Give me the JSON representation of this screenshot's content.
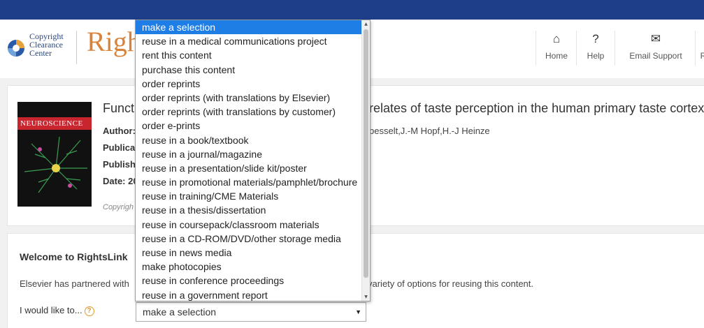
{
  "logo": {
    "lines": [
      "Copyright",
      "Clearance",
      "Center"
    ]
  },
  "brand": {
    "title": "RightsLink"
  },
  "nav": [
    {
      "label": "Home",
      "icon": "home-icon",
      "glyph": "⌂"
    },
    {
      "label": "Help",
      "icon": "help-icon",
      "glyph": "?"
    },
    {
      "label": "Email Support",
      "icon": "email-icon",
      "glyph": "✉"
    },
    {
      "label": "R",
      "icon": "partial-nav-icon",
      "glyph": ""
    }
  ],
  "article": {
    "cover_title": "NEUROSCIENCE",
    "title_left": "Funct",
    "title_right": "relates of taste perception in the human primary taste cortex",
    "meta_left": [
      "Author:",
      "Publica",
      "Publish",
      "Date: 20"
    ],
    "authors_right": "besselt,J.-M Hopf,H.-J Heinze",
    "copyright": "Copyrigh"
  },
  "welcome": {
    "heading": "Welcome to RightsLink",
    "partner_left": "Elsevier has partnered with",
    "partner_right": "variety of options for reusing this content.",
    "would_like": "I would like to...",
    "help_glyph": "?"
  },
  "select": {
    "value": "make a selection",
    "options": [
      "make a selection",
      "reuse in a medical communications project",
      "rent this content",
      "purchase this content",
      "order reprints",
      "order reprints (with translations by Elsevier)",
      "order reprints (with translations by customer)",
      "order e-prints",
      "reuse in a book/textbook",
      "reuse in a journal/magazine",
      "reuse in a presentation/slide kit/poster",
      "reuse in promotional materials/pamphlet/brochure",
      "reuse in training/CME Materials",
      "reuse in a thesis/dissertation",
      "reuse in coursepack/classroom materials",
      "reuse in a CD-ROM/DVD/other storage media",
      "reuse in news media",
      "make photocopies",
      "reuse in conference proceedings",
      "reuse in a government report"
    ]
  },
  "colors": {
    "topbar": "#1d3f8a",
    "brand": "#d9833a",
    "selected": "#1e7ee6"
  }
}
